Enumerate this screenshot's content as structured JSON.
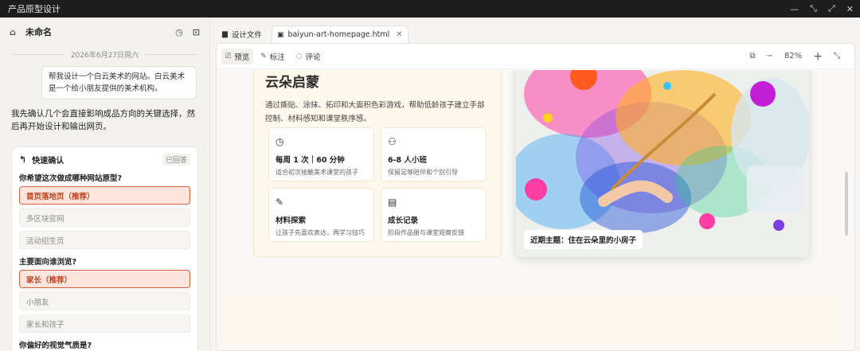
{
  "window": {
    "title": "产品原型设计",
    "controls": [
      "—",
      "⤡",
      "⤢",
      "✕"
    ]
  },
  "sidebar": {
    "project_name": "未命名",
    "date": "2026年6月27日周六",
    "user_message": "帮我设计一个白云美术的网站。白云美术是一个给小朋友提供的美术机构。",
    "assistant_reply": "我先确认几个会直接影响成品方向的关键选择，然后再开始设计和输出网页。",
    "quick_confirm": {
      "title": "快速确认",
      "status": "已回答",
      "questions": [
        {
          "label": "你希望这次做成哪种网站原型?",
          "options": [
            {
              "text": "首页落地页（推荐）",
              "selected": true
            },
            {
              "text": "多区块官网",
              "selected": false
            },
            {
              "text": "活动招生页",
              "selected": false
            }
          ]
        },
        {
          "label": "主要面向谁浏览?",
          "options": [
            {
              "text": "家长（推荐）",
              "selected": true
            },
            {
              "text": "小朋友",
              "selected": false
            },
            {
              "text": "家长和孩子",
              "selected": false
            }
          ]
        },
        {
          "label": "你偏好的视觉气质是?",
          "options": []
        }
      ]
    }
  },
  "tabs": [
    {
      "label": "设计文件",
      "icon": "folder-icon",
      "active": false
    },
    {
      "label": "baiyun-art-homepage.html",
      "icon": "file-icon",
      "active": true,
      "close": "✕"
    }
  ],
  "toolbar": {
    "preview": "预览",
    "annotate": "标注",
    "comment": "评论",
    "zoom": "82%"
  },
  "preview": {
    "hero_title": "云朵启蒙",
    "hero_desc": "通过撕贴、涂抹、拓印和大面积色彩游戏，帮助低龄孩子建立手部控制、材料感知和课堂秩序感。",
    "features": [
      {
        "icon": "clock-icon",
        "glyph": "◷",
        "title": "每周 1 次｜60 分钟",
        "desc": "适合初次接触美术课堂的孩子"
      },
      {
        "icon": "users-icon",
        "glyph": "⚇",
        "title": "6-8 人小班",
        "desc": "保留足够陪伴和个别引导"
      },
      {
        "icon": "brush-icon",
        "glyph": "✎",
        "title": "材料探索",
        "desc": "让孩子先喜欢表达，再学习技巧"
      },
      {
        "icon": "file-check-icon",
        "glyph": "▤",
        "title": "成长记录",
        "desc": "阶段作品册与课堂观察反馈"
      }
    ],
    "image_caption": "近期主题：住在云朵里的小房子"
  }
}
